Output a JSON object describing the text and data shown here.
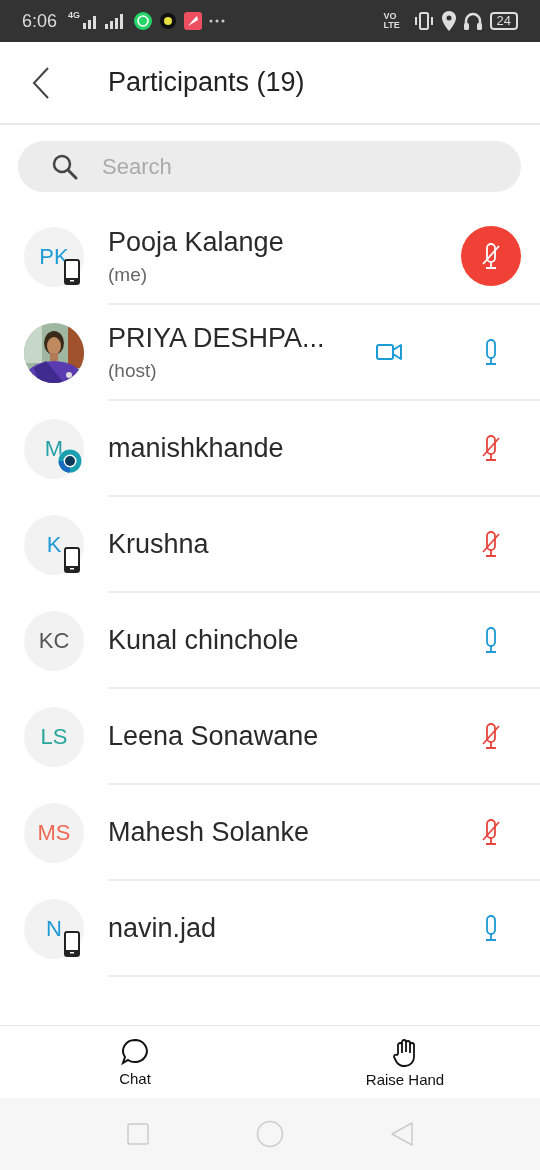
{
  "status_bar": {
    "time": "6:06",
    "network": "4G",
    "volte": "VO LTE",
    "battery": "24"
  },
  "header": {
    "title": "Participants (19)"
  },
  "search": {
    "placeholder": "Search"
  },
  "participants": [
    {
      "name": "Pooja Kalange",
      "role": "(me)",
      "initials": "PK",
      "color": "#1e9bd7",
      "kind": "initials",
      "phone_badge": true,
      "app_badge": false,
      "muted": true,
      "self": true,
      "video": false
    },
    {
      "name": "PRIYA DESHPA...",
      "role": "(host)",
      "phone_badge": false,
      "app_badge": false,
      "muted": false,
      "self": false,
      "video": true
    },
    {
      "name": "manishkhande",
      "initials": "M",
      "color": "#26a0a8",
      "kind": "initials",
      "phone_badge": false,
      "app_badge": true,
      "muted": true,
      "self": false,
      "video": false
    },
    {
      "name": "Krushna",
      "initials": "K",
      "color": "#1e9bd7",
      "kind": "initials",
      "phone_badge": true,
      "app_badge": false,
      "muted": true,
      "self": false,
      "video": false
    },
    {
      "name": "Kunal chinchole",
      "initials": "KC",
      "color": "#555555",
      "kind": "initials",
      "phone_badge": false,
      "app_badge": false,
      "muted": false,
      "self": false,
      "video": false
    },
    {
      "name": "Leena Sonawane",
      "initials": "LS",
      "color": "#26a69a",
      "kind": "initials",
      "phone_badge": false,
      "app_badge": false,
      "muted": true,
      "self": false,
      "video": false
    },
    {
      "name": "Mahesh Solanke",
      "initials": "MS",
      "color": "#ef6a55",
      "kind": "initials",
      "phone_badge": false,
      "app_badge": false,
      "muted": true,
      "self": false,
      "video": false
    },
    {
      "name": "navin.jad",
      "initials": "N",
      "color": "#1e9bd7",
      "kind": "initials",
      "phone_badge": true,
      "app_badge": false,
      "muted": false,
      "self": false,
      "video": false
    }
  ],
  "bottom_bar": [
    {
      "label": "Chat",
      "kind": "chat"
    },
    {
      "label": "Raise Hand",
      "kind": "hand"
    }
  ]
}
